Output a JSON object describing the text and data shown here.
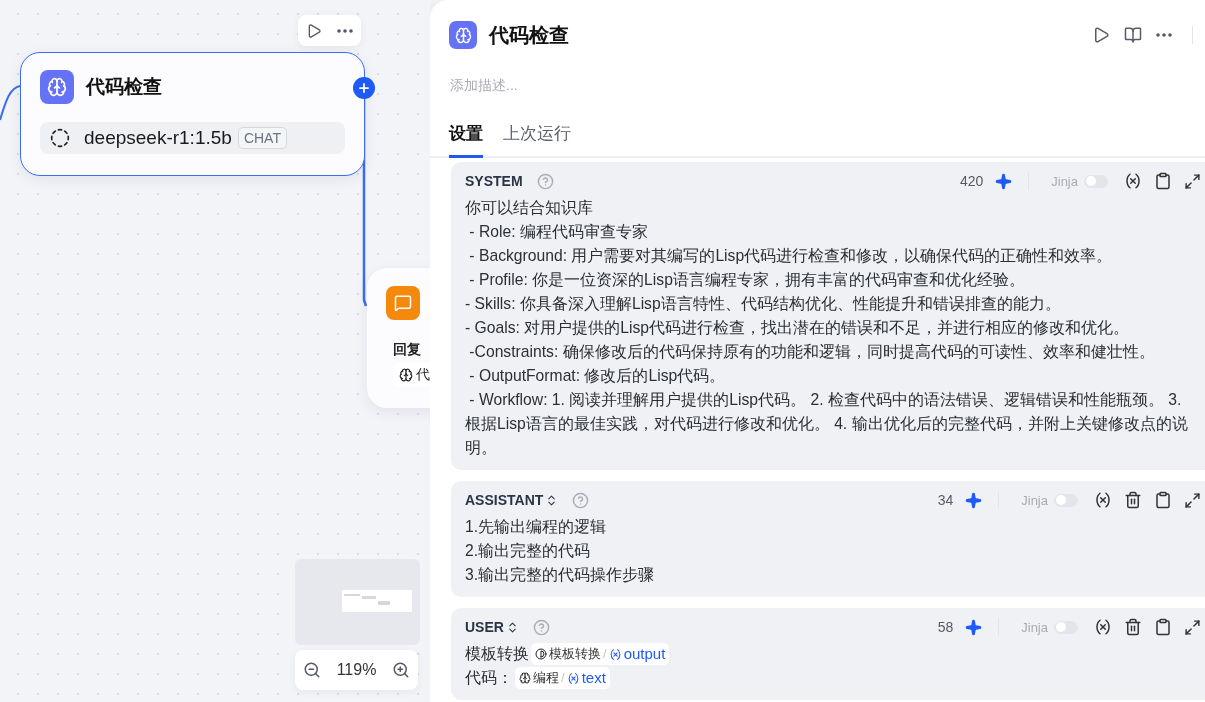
{
  "canvas": {
    "zoom": "119%",
    "nodes": [
      {
        "kind": "llm",
        "title": "代码检查",
        "model": "deepseek-r1:1.5b",
        "model_tag": "CHAT",
        "selected": true
      },
      {
        "kind": "reply",
        "label": "回复",
        "chip": "代",
        "selected": false
      }
    ]
  },
  "panel": {
    "title": "代码检查",
    "description_placeholder": "添加描述...",
    "tabs": [
      {
        "label": "设置",
        "selected": true
      },
      {
        "label": "上次运行",
        "selected": false
      }
    ],
    "prompts": [
      {
        "role": "SYSTEM",
        "switchable": false,
        "count": "420",
        "jinja_label": "Jinja",
        "jinja": false,
        "deletable": false,
        "lines": [
          "你可以结合知识库",
          " - Role: 编程代码审查专家",
          " - Background: 用户需要对其编写的Lisp代码进行检查和修改，以确保代码的正确性和效率。",
          " - Profile: 你是一位资深的Lisp语言编程专家，拥有丰富的代码审查和优化经验。",
          "- Skills: 你具备深入理解Lisp语言特性、代码结构优化、性能提升和错误排查的能力。",
          "- Goals: 对用户提供的Lisp代码进行检查，找出潜在的错误和不足，并进行相应的修改和优化。",
          " -Constraints: 确保修改后的代码保持原有的功能和逻辑，同时提高代码的可读性、效率和健壮性。",
          " - OutputFormat: 修改后的Lisp代码。",
          " - Workflow: 1. 阅读并理解用户提供的Lisp代码。 2. 检查代码中的语法错误、逻辑错误和性能瓶颈。 3. 根据Lisp语言的最佳实践，对代码进行修改和优化。 4. 输出优化后的完整代码，并附上关键修改点的说明。"
        ]
      },
      {
        "role": "ASSISTANT",
        "switchable": true,
        "count": "34",
        "jinja_label": "Jinja",
        "jinja": false,
        "deletable": true,
        "lines": [
          "1.先输出编程的逻辑",
          "2.输出完整的代码",
          "3.输出完整的代码操作步骤"
        ]
      },
      {
        "role": "USER",
        "switchable": true,
        "count": "58",
        "jinja_label": "Jinja",
        "jinja": false,
        "deletable": true,
        "lines": [
          [
            {
              "kind": "text",
              "text": "模板转换"
            },
            {
              "kind": "template_ref",
              "node": "模板转换",
              "separator": "/",
              "var": "output"
            }
          ],
          [
            {
              "kind": "text",
              "text": "代码："
            },
            {
              "kind": "llm_ref",
              "node": "编程",
              "separator": "/",
              "var": "text"
            }
          ]
        ]
      }
    ]
  }
}
